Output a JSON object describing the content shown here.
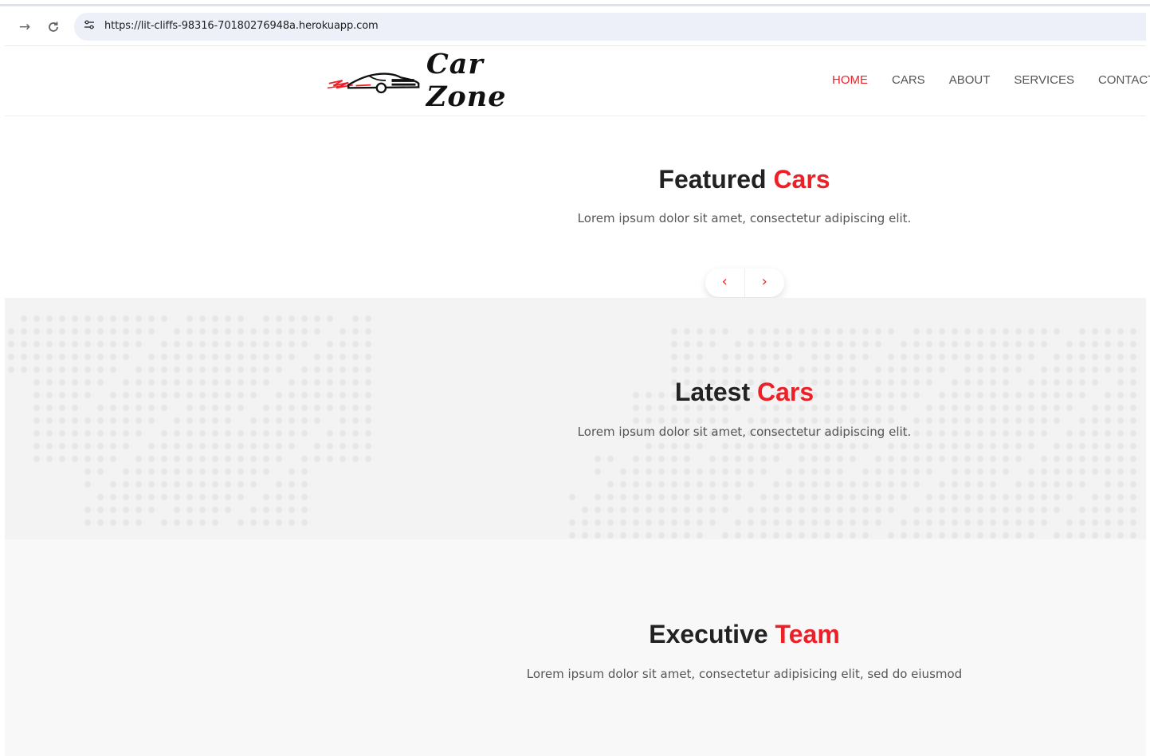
{
  "browser": {
    "url": "https://lit-cliffs-98316-70180276948a.herokuapp.com",
    "back_icon": "→",
    "reload_icon": "C",
    "site_info_icon": "⚙"
  },
  "header": {
    "logo_text": "Car Zone",
    "nav": [
      {
        "label": "HOME",
        "active": true
      },
      {
        "label": "CARS",
        "active": false
      },
      {
        "label": "ABOUT",
        "active": false
      },
      {
        "label": "SERVICES",
        "active": false
      },
      {
        "label": "CONTACT",
        "active": false
      }
    ]
  },
  "featured": {
    "title_main": "Featured",
    "title_accent": "Cars",
    "subtitle": "Lorem ipsum dolor sit amet, consectetur adipiscing elit.",
    "prev_icon": "‹",
    "next_icon": "›"
  },
  "latest": {
    "title_main": "Latest",
    "title_accent": "Cars",
    "subtitle": "Lorem ipsum dolor sit amet, consectetur adipiscing elit."
  },
  "executive": {
    "title_main": "Executive",
    "title_accent": "Team",
    "subtitle": "Lorem ipsum dolor sit amet, consectetur adipisicing elit, sed do eiusmod"
  },
  "colors": {
    "accent": "#ec2128",
    "text_dark": "#222222",
    "text_muted": "#555555"
  }
}
